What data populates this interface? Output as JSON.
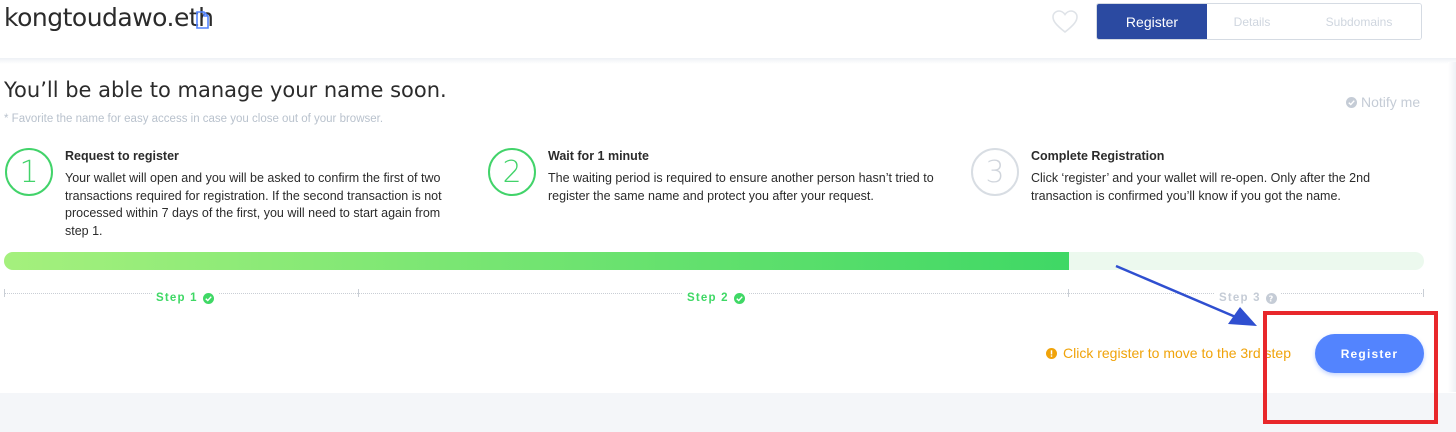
{
  "header": {
    "domain_name": "kongtoudawo.eth",
    "tabs": [
      {
        "label": "Register",
        "active": true
      },
      {
        "label": "Details",
        "active": false
      },
      {
        "label": "Subdomains",
        "active": false
      }
    ]
  },
  "main": {
    "headline": "You’ll be able to manage your name soon.",
    "subnote": "* Favorite the name for easy access in case you close out of your browser.",
    "notify_label": "Notify me",
    "steps": [
      {
        "number": "1",
        "title": "Request to register",
        "description": "Your wallet will open and you will be asked to confirm the first of two transactions required for registration. If the second transaction is not processed within 7 days of the first, you will need to start again from step 1."
      },
      {
        "number": "2",
        "title": "Wait for 1 minute",
        "description": "The waiting period is required to ensure another person hasn’t tried to register the same name and protect you after your request."
      },
      {
        "number": "3",
        "title": "Complete Registration",
        "description": "Click ‘register’ and your wallet will re-open. Only after the 2nd transaction is confirmed you’ll know if you got the name."
      }
    ],
    "progress_fraction": 0.75,
    "step_labels": [
      {
        "label": "Step 1",
        "status": "complete"
      },
      {
        "label": "Step 2",
        "status": "complete"
      },
      {
        "label": "Step 3",
        "status": "pending"
      }
    ],
    "hint": "Click register to move to the 3rd step",
    "register_button": "Register"
  },
  "colors": {
    "brand_blue": "#2b4aa1",
    "button_blue": "#5384fe",
    "success_green": "#42d36a",
    "warning_orange": "#f0a30a",
    "annotation_red": "#e8272b"
  },
  "icons": [
    "document-icon",
    "heart-icon",
    "check-circle-icon",
    "question-circle-icon",
    "warning-circle-icon",
    "arrow-annotation"
  ]
}
